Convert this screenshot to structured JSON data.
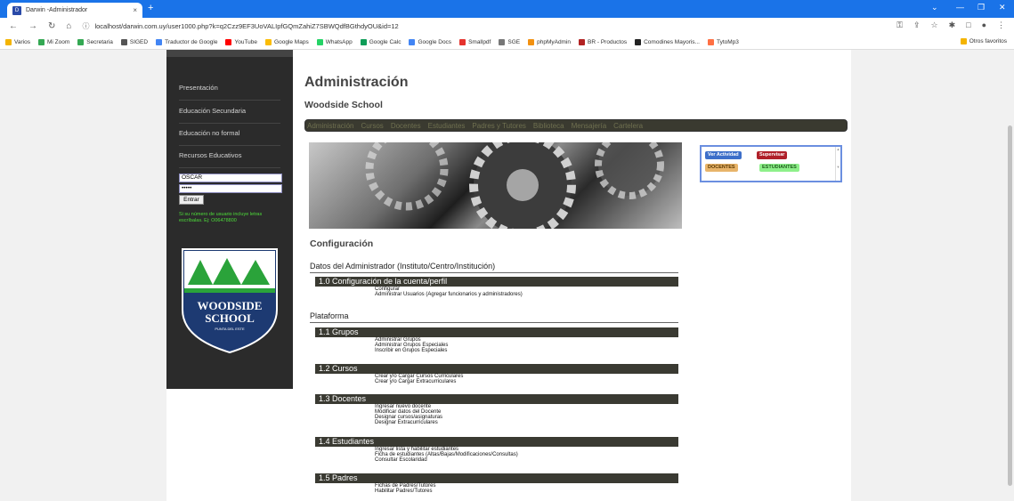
{
  "browser": {
    "tab_title": "Darwin -Administrador",
    "tab_close": "×",
    "new_tab": "+",
    "url": "localhost/darwin.com.uy/user1000.php?k=q2Czz9EF3UoVALIpfGQmZahiZ7SBWQdfBGthdyOU&id=12",
    "bookmarks": [
      {
        "label": "Varios",
        "color": "#f4b400"
      },
      {
        "label": "Mi Zoom",
        "color": "#34a853"
      },
      {
        "label": "Secretaria",
        "color": "#34a853"
      },
      {
        "label": "SIGED",
        "color": "#555555"
      },
      {
        "label": "Traductor de Google",
        "color": "#4285f4"
      },
      {
        "label": "YouTube",
        "color": "#ff0000"
      },
      {
        "label": "Google Maps",
        "color": "#fbbc05"
      },
      {
        "label": "WhatsApp",
        "color": "#25d366"
      },
      {
        "label": "Google Calc",
        "color": "#0f9d58"
      },
      {
        "label": "Google Docs",
        "color": "#4285f4"
      },
      {
        "label": "Smallpdf",
        "color": "#e5322d"
      },
      {
        "label": "SGE",
        "color": "#777777"
      },
      {
        "label": "phpMyAdmin",
        "color": "#f29111"
      },
      {
        "label": "BR - Productos",
        "color": "#b22222"
      },
      {
        "label": "Comodines Mayoris...",
        "color": "#222222"
      },
      {
        "label": "TytoMp3",
        "color": "#ff7043"
      }
    ],
    "other_bookmarks": "Otros favoritos"
  },
  "sidebar": {
    "items": [
      "Presentación",
      "Educación Secundaria",
      "Educación no formal",
      "Recursos Educativos"
    ],
    "username_value": "OSCAR",
    "password_value": "•••••",
    "login_button": "Entrar",
    "hint": "Si su número de usuario incluye letras escríbalas. Ej: O06478800",
    "logo_line1": "WOODSIDE",
    "logo_line2": "SCHOOL",
    "logo_line3": "PUNTA DEL ESTE"
  },
  "header": {
    "title": "Administración",
    "school": "Woodside School"
  },
  "menu": [
    "Administración",
    "Cursos",
    "Docentes",
    "Estudiantes",
    "Padres y Tutores",
    "Biblioteca",
    "Mensajería",
    "Cartelera"
  ],
  "widget": {
    "ver_actividad": "Ver Actividad",
    "supervisar": "Supervisar",
    "docentes": "DOCENTES",
    "estudiantes": "ESTUDIANTES"
  },
  "config": {
    "title": "Configuración",
    "section_admin": "Datos del Administrador (Instituto/Centro/Institución)",
    "section_platform": "Plataforma",
    "groups": [
      {
        "title": "1.0 Configuración de la cuenta/perfil",
        "links": [
          "Configurar",
          "Administrar Usuarios (Agregar funcionarios y administradores)"
        ]
      },
      {
        "title": "1.1 Grupos",
        "links": [
          "Administrar Grupos",
          "Administrar Grupos Especiales",
          "Inscribir en Grupos Especiales"
        ]
      },
      {
        "title": "1.2 Cursos",
        "links": [
          "Crear y/o Cargar Cursos Curriculares",
          "Crear y/o Cargar Extracurriculares"
        ]
      },
      {
        "title": "1.3 Docentes",
        "links": [
          "Ingresar nuevo docente",
          "Modificar datos del Docente",
          "Designar cursos/asignaturas",
          "Designar Extracurriculares"
        ]
      },
      {
        "title": "1.4 Estudiantes",
        "links": [
          "Ingresar lista y habilitar estudiantes",
          "Ficha de estudiantes (Altas/Bajas/Modificaciones/Consultas)",
          "Consultar Escolaridad"
        ]
      },
      {
        "title": "1.5 Padres",
        "links": [
          "Fichas de Padres/Tutores",
          "Habilitar Padres/Tutores"
        ]
      }
    ]
  }
}
